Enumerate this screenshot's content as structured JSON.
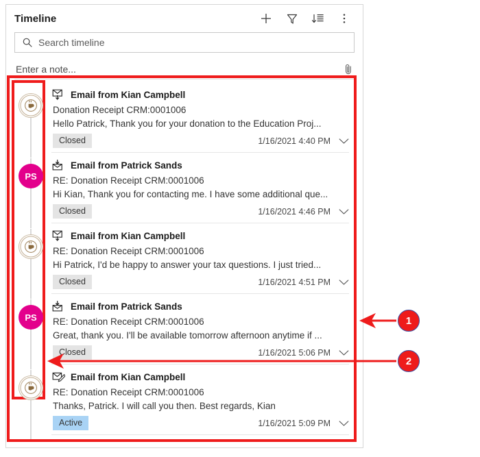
{
  "panel": {
    "title": "Timeline",
    "header_icons": [
      {
        "name": "add-icon",
        "label": "Add"
      },
      {
        "name": "filter-icon",
        "label": "Filter"
      },
      {
        "name": "sort-icon",
        "label": "Sort"
      },
      {
        "name": "more-commands-icon",
        "label": "More commands"
      }
    ],
    "search": {
      "placeholder": "Search timeline",
      "value": "",
      "icon": "search-icon"
    },
    "note": {
      "placeholder": "Enter a note...",
      "value": "",
      "attach_icon": "paperclip-icon"
    }
  },
  "timeline": {
    "items": [
      {
        "icon": "email-outgoing-icon",
        "avatar_type": "logo",
        "avatar_text": "",
        "avatar_color": "#8a6a3e",
        "title": "Email from Kian Campbell",
        "subject": "Donation Receipt CRM:0001006",
        "preview": "Hello Patrick,   Thank you for your donation to the Education Proj...",
        "status": "Closed",
        "status_kind": "closed",
        "timestamp": "1/16/2021 4:40 PM",
        "expand_icon": "chevron-down-icon"
      },
      {
        "icon": "email-incoming-icon",
        "avatar_type": "initials",
        "avatar_text": "PS",
        "avatar_color": "#e3008c",
        "title": "Email from Patrick Sands",
        "subject": "RE: Donation Receipt CRM:0001006",
        "preview": "Hi Kian, Thank you for contacting me. I have some additional que...",
        "status": "Closed",
        "status_kind": "closed",
        "timestamp": "1/16/2021 4:46 PM",
        "expand_icon": "chevron-down-icon"
      },
      {
        "icon": "email-outgoing-icon",
        "avatar_type": "logo",
        "avatar_text": "",
        "avatar_color": "#8a6a3e",
        "title": "Email from Kian Campbell",
        "subject": "RE: Donation Receipt CRM:0001006",
        "preview": "Hi Patrick,   I'd be happy to answer your tax questions. I just tried...",
        "status": "Closed",
        "status_kind": "closed",
        "timestamp": "1/16/2021 4:51 PM",
        "expand_icon": "chevron-down-icon"
      },
      {
        "icon": "email-incoming-icon",
        "avatar_type": "initials",
        "avatar_text": "PS",
        "avatar_color": "#e3008c",
        "title": "Email from Patrick Sands",
        "subject": "RE: Donation Receipt CRM:0001006",
        "preview": "Great, thank you. I'll be available tomorrow afternoon anytime if ...",
        "status": "Closed",
        "status_kind": "closed",
        "timestamp": "1/16/2021 5:06 PM",
        "expand_icon": "chevron-down-icon"
      },
      {
        "icon": "email-draft-icon",
        "avatar_type": "logo",
        "avatar_text": "",
        "avatar_color": "#8a6a3e",
        "title": "Email from Kian Campbell",
        "subject": "RE: Donation Receipt CRM:0001006",
        "preview": "Thanks, Patrick. I will call you then.   Best regards, Kian",
        "status": "Active",
        "status_kind": "active",
        "timestamp": "1/16/2021 5:09 PM",
        "expand_icon": "chevron-down-icon"
      }
    ]
  },
  "annotations": {
    "callouts": [
      {
        "number": "1",
        "target": "timeline-records-outer-highlight"
      },
      {
        "number": "2",
        "target": "timeline-rail-inner-highlight"
      }
    ],
    "highlight_color": "#ef1c1c"
  },
  "colors": {
    "highlight": "#ef1c1c",
    "callout_fill": "#ee1b1b",
    "callout_border": "#3b4aa0",
    "avatar_person": "#e3008c",
    "badge_closed": "#e4e4e4",
    "badge_active": "#a9d3f5"
  }
}
